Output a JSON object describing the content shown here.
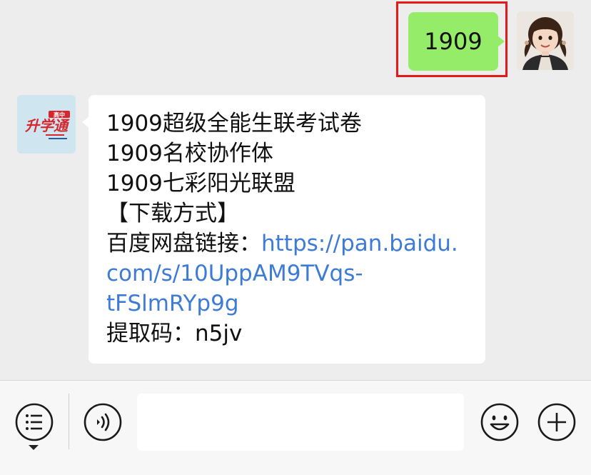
{
  "outgoing_message": {
    "text": "1909"
  },
  "incoming_message": {
    "line1": "1909超级全能生联考试卷",
    "line2": "1909名校协作体",
    "line3": "1909七彩阳光联盟",
    "line4": "【下载方式】",
    "link_label": "百度网盘链接：",
    "link_part1": "https://pan.baidu.",
    "link_part2": "com/s/10UppAM9TVqs-",
    "link_part3": "tFSlmRYp9g",
    "code_label": "提取码：",
    "code_value": "n5jv"
  },
  "bot_avatar": {
    "logo_text": "升学通",
    "badge_text": "高中"
  },
  "colors": {
    "outgoing_bubble": "#95ec69",
    "highlight_border": "#e41a1a",
    "link": "#3d7bd6",
    "chat_background": "#ededed"
  },
  "toolbar": {
    "icons": [
      "menu-icon",
      "voice-icon",
      "emoji-icon",
      "plus-icon"
    ],
    "input_value": ""
  }
}
